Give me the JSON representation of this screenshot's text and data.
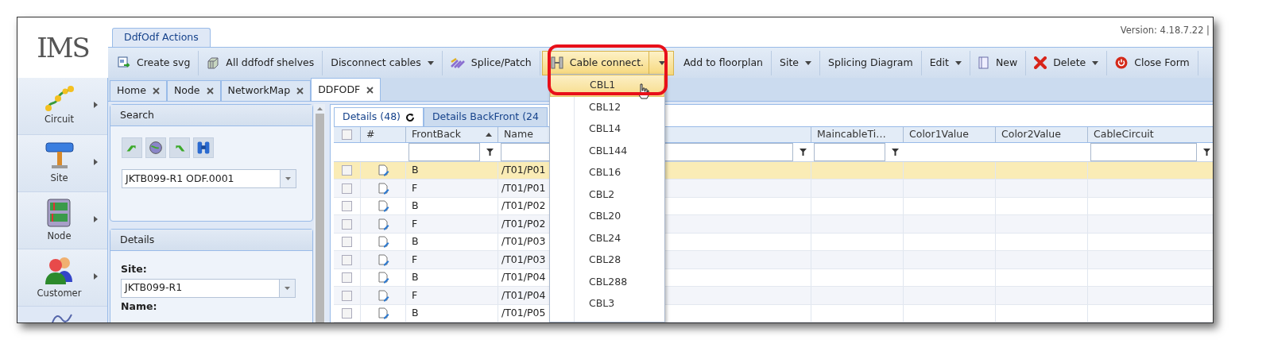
{
  "logo": "IMS",
  "version": "Version: 4.18.7.22 |",
  "ribbon_tabs": [
    {
      "label": "DdfOdf Actions",
      "selected": true
    }
  ],
  "toolbar": [
    {
      "label": "Create svg",
      "kind": "button",
      "active": false
    },
    {
      "label": "All ddfodf shelves",
      "kind": "button",
      "active": false
    },
    {
      "label": "Disconnect cables",
      "kind": "menu",
      "active": false
    },
    {
      "label": "Splice/Patch",
      "kind": "button",
      "active": false
    },
    {
      "label": "Cable connect.",
      "kind": "split",
      "active": true
    },
    {
      "label": "Add to floorplan",
      "kind": "button",
      "active": false
    },
    {
      "label": "Site",
      "kind": "menu",
      "active": false
    },
    {
      "label": "Splicing Diagram",
      "kind": "button",
      "active": false
    },
    {
      "label": "Edit",
      "kind": "menu",
      "active": false
    },
    {
      "label": "New",
      "kind": "button",
      "active": false
    },
    {
      "label": "Delete",
      "kind": "menu",
      "active": false
    },
    {
      "label": "Close Form",
      "kind": "button",
      "active": false
    }
  ],
  "sidebar": [
    {
      "label": "Circuit"
    },
    {
      "label": "Site"
    },
    {
      "label": "Node"
    },
    {
      "label": "Customer"
    }
  ],
  "doc_tabs": [
    {
      "label": "Home",
      "selected": false
    },
    {
      "label": "Node",
      "selected": false
    },
    {
      "label": "NetworkMap",
      "selected": false
    },
    {
      "label": "DDFODF",
      "selected": true
    }
  ],
  "search_panel": {
    "title": "Search",
    "value": "JKTB099-R1 ODF.0001"
  },
  "details_panel": {
    "title": "Details",
    "fields": [
      {
        "label": "Site:",
        "value": "JKTB099-R1"
      },
      {
        "label": "Name:"
      }
    ]
  },
  "grid": {
    "tabs": [
      {
        "label": "Details (48)",
        "selected": true
      },
      {
        "label": "Details BackFront (24",
        "selected": false
      }
    ],
    "columns": [
      {
        "label": "#",
        "filter": false,
        "sorted": false
      },
      {
        "label": "FrontBack",
        "filter": true,
        "sorted": true
      },
      {
        "label": "Name",
        "filter": true,
        "sorted": false
      },
      {
        "label": "MaincableTi…",
        "filter": true,
        "sorted": false
      },
      {
        "label": "Color1Value",
        "filter": false,
        "sorted": false
      },
      {
        "label": "Color2Value",
        "filter": false,
        "sorted": false
      },
      {
        "label": "CableCircuit",
        "filter": true,
        "sorted": false
      }
    ],
    "rows": [
      {
        "front_back": "B",
        "name": "/T01/P01",
        "selected": true,
        "checked": false
      },
      {
        "front_back": "F",
        "name": "/T01/P01",
        "selected": false,
        "checked": false
      },
      {
        "front_back": "B",
        "name": "/T01/P02",
        "selected": false,
        "checked": false
      },
      {
        "front_back": "F",
        "name": "/T01/P02",
        "selected": false,
        "checked": false
      },
      {
        "front_back": "B",
        "name": "/T01/P03",
        "selected": false,
        "checked": false
      },
      {
        "front_back": "F",
        "name": "/T01/P03",
        "selected": false,
        "checked": false
      },
      {
        "front_back": "B",
        "name": "/T01/P04",
        "selected": false,
        "checked": false
      },
      {
        "front_back": "F",
        "name": "/T01/P04",
        "selected": false,
        "checked": false
      },
      {
        "front_back": "B",
        "name": "/T01/P05",
        "selected": false,
        "checked": false
      }
    ]
  },
  "dropdown": [
    {
      "label": "CBL1",
      "selected": true
    },
    {
      "label": "CBL12",
      "selected": false
    },
    {
      "label": "CBL14",
      "selected": false
    },
    {
      "label": "CBL144",
      "selected": false
    },
    {
      "label": "CBL16",
      "selected": false
    },
    {
      "label": "CBL2",
      "selected": false
    },
    {
      "label": "CBL20",
      "selected": false
    },
    {
      "label": "CBL24",
      "selected": false
    },
    {
      "label": "CBL28",
      "selected": false
    },
    {
      "label": "CBL288",
      "selected": false
    },
    {
      "label": "CBL3",
      "selected": false
    }
  ]
}
